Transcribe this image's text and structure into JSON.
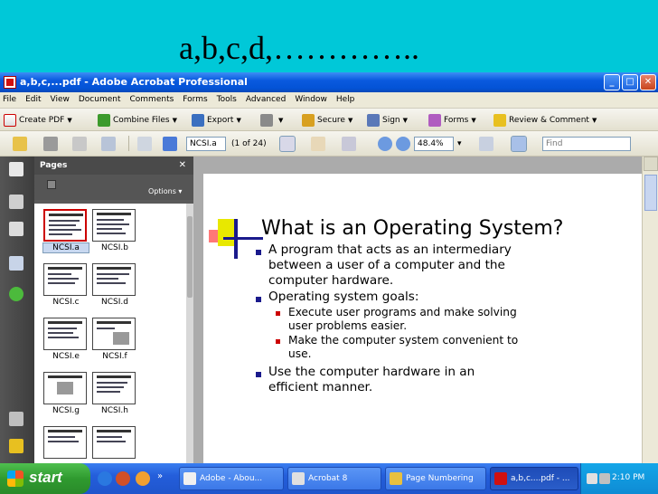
{
  "slide_caption": "a,b,c,d,…………..",
  "window": {
    "title": "a,b,c,...pdf - Adobe Acrobat Professional",
    "controls": {
      "minimize": "_",
      "maximize": "□",
      "close": "✕"
    }
  },
  "menu": [
    "File",
    "Edit",
    "View",
    "Document",
    "Comments",
    "Forms",
    "Tools",
    "Advanced",
    "Window",
    "Help"
  ],
  "toolbar1": {
    "create_pdf": "Create PDF",
    "combine_files": "Combine Files",
    "export": "Export",
    "secure": "Secure",
    "sign": "Sign",
    "forms": "Forms",
    "review_comment": "Review & Comment"
  },
  "toolbar2": {
    "page_field": "NCSI.a",
    "page_count": "(1 of 24)",
    "zoom": "48.4%",
    "find_placeholder": "Find"
  },
  "pages_panel": {
    "title": "Pages",
    "close": "✕",
    "options": "Options",
    "thumbnails": [
      "NCSI.a",
      "NCSI.b",
      "NCSI.c",
      "NCSI.d",
      "NCSI.e",
      "NCSI.f",
      "NCSI.g",
      "NCSI.h"
    ]
  },
  "slide": {
    "title": "What is an Operating System?",
    "bullets": [
      {
        "lines": [
          "A program that acts as an intermediary",
          "between a user of a computer and the",
          "computer hardware."
        ]
      },
      {
        "lines": [
          "Operating system goals:"
        ],
        "sub": [
          {
            "lines": [
              "Execute user programs and make solving",
              "user problems easier."
            ]
          },
          {
            "lines": [
              "Make the computer system convenient to",
              "use."
            ]
          }
        ]
      },
      {
        "lines": [
          "Use the computer hardware in an",
          "efficient manner."
        ]
      }
    ]
  },
  "taskbar": {
    "start": "start",
    "tasks": [
      "Adobe - Abou...",
      "Acrobat 8",
      "Page Numbering",
      "a,b,c....pdf - ..."
    ],
    "clock": "2:10 PM"
  },
  "colors": {
    "banner": "#00c8d8",
    "titlebar": "#0a5adf",
    "taskbar": "#245edb",
    "start": "#2f9a2f",
    "slide_accent": "#1a1a8c"
  }
}
